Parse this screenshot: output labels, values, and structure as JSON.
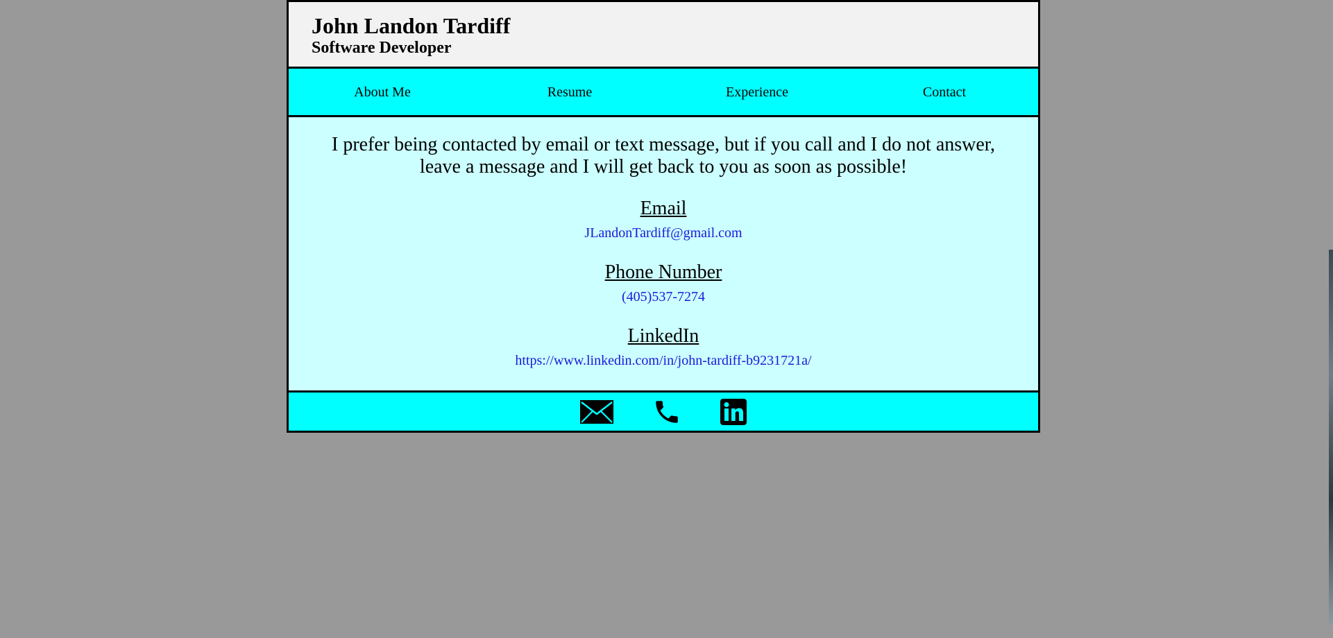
{
  "header": {
    "name": "John Landon Tardiff",
    "role": "Software Developer"
  },
  "nav": {
    "items": [
      {
        "label": "About Me"
      },
      {
        "label": "Resume"
      },
      {
        "label": "Experience"
      },
      {
        "label": "Contact"
      }
    ]
  },
  "contact": {
    "intro_line1": "I prefer being contacted by email or text message, but if you call and I do not answer,",
    "intro_line2": "leave a message and I will get back to you as soon as possible!",
    "email_title": "Email",
    "email_value": "JLandonTardiff@gmail.com",
    "phone_title": "Phone Number",
    "phone_value": "(405)537-7274",
    "linkedin_title": "LinkedIn",
    "linkedin_value": "https://www.linkedin.com/in/john-tardiff-b9231721a/"
  },
  "footer": {
    "icons": [
      "envelope-icon",
      "phone-icon",
      "linkedin-icon"
    ]
  },
  "colors": {
    "background": "#999999",
    "header_bg": "#f2f2f2",
    "nav_bg": "#00ffff",
    "content_bg": "#ccffff",
    "link": "#1a1adb",
    "border": "#000000"
  }
}
